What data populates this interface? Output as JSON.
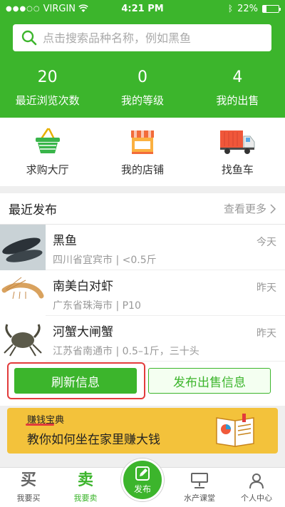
{
  "status_bar": {
    "signal": "●●●○○",
    "carrier": "VIRGIN",
    "time": "4:21 PM",
    "battery": "22%"
  },
  "search": {
    "placeholder": "点击搜索品种名称，例如黑鱼"
  },
  "stats": [
    {
      "value": "20",
      "label": "最近浏览次数"
    },
    {
      "value": "0",
      "label": "我的等级"
    },
    {
      "value": "4",
      "label": "我的出售"
    }
  ],
  "actions": [
    {
      "label": "求购大厅",
      "icon": "basket-icon"
    },
    {
      "label": "我的店铺",
      "icon": "store-icon"
    },
    {
      "label": "找鱼车",
      "icon": "truck-icon"
    }
  ],
  "recent": {
    "title": "最近发布",
    "more": "查看更多",
    "items": [
      {
        "name": "黑鱼",
        "meta": "四川省宜宾市 | <0.5斤",
        "date": "今天",
        "icon": "fish-icon"
      },
      {
        "name": "南美白对虾",
        "meta": "广东省珠海市 | P10",
        "date": "昨天",
        "icon": "shrimp-icon"
      },
      {
        "name": "河蟹大闸蟹",
        "meta": "江苏省南通市 | 0.5–1斤，三十头",
        "date": "昨天",
        "icon": "crab-icon"
      }
    ]
  },
  "buttons": {
    "refresh": "刷新信息",
    "publish": "发布出售信息"
  },
  "banner": {
    "tag": "赚钱宝典",
    "text": "教你如何坐在家里赚大钱"
  },
  "tabs": [
    {
      "glyph": "买",
      "label": "我要买"
    },
    {
      "glyph": "卖",
      "label": "我要卖"
    },
    {
      "glyph": "",
      "label": ""
    },
    {
      "glyph": "",
      "label": "水产课堂"
    },
    {
      "glyph": "",
      "label": "个人中心"
    }
  ],
  "fab": {
    "label": "发布"
  },
  "colors": {
    "primary": "#3cb52c",
    "highlight_border": "#e23b3b",
    "banner": "#f3c23b"
  }
}
